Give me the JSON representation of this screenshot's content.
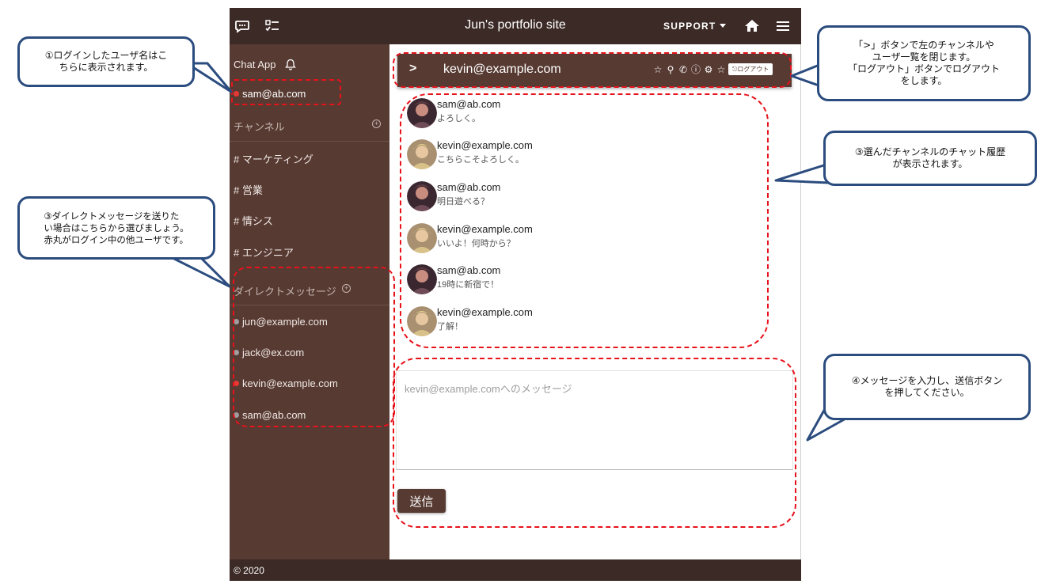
{
  "topbar": {
    "title": "Jun's portfolio site",
    "support_label": "SUPPORT",
    "icons": [
      "chat-bubble-icon",
      "checklist-icon",
      "home-icon",
      "menu-icon"
    ]
  },
  "sidebar": {
    "app_name": "Chat App",
    "current_user": "sam@ab.com",
    "channels_heading": "チャンネル",
    "channels": [
      "# マーケティング",
      "# 営業",
      "# 情シス",
      "# エンジニア"
    ],
    "dm_heading": "ダイレクトメッセージ",
    "direct_users": [
      {
        "name": "jun@example.com",
        "status_color": "#9e9e9e"
      },
      {
        "name": "jack@ex.com",
        "status_color": "#9e9e9e"
      },
      {
        "name": "kevin@example.com",
        "status_color": "#e53935"
      },
      {
        "name": "sam@ab.com",
        "status_color": "#9e9e9e"
      }
    ],
    "online_color": "#e53935"
  },
  "chat": {
    "toggle_label": ">",
    "title": "kevin@example.com",
    "header_icons": [
      "☆",
      "⚲",
      "✆",
      "ⓘ",
      "⚙",
      "☆"
    ],
    "logout_label": "ログアウト",
    "messages": [
      {
        "user": "sam@ab.com",
        "text": "よろしく。"
      },
      {
        "user": "kevin@example.com",
        "text": "こちらこそよろしく。"
      },
      {
        "user": "sam@ab.com",
        "text": "明日遊べる？"
      },
      {
        "user": "kevin@example.com",
        "text": "いいよ！何時から？"
      },
      {
        "user": "sam@ab.com",
        "text": "19時に新宿で！"
      },
      {
        "user": "kevin@example.com",
        "text": "了解！"
      }
    ],
    "input_placeholder": "kevin@example.comへのメッセージ",
    "send_label": "送信"
  },
  "footer": {
    "text": "© 2020"
  },
  "annotations": {
    "login_user": "①ログインしたユーザ名はこ\nちらに表示されます。",
    "direct_message": "③ダイレクトメッセージを送りた\nい場合はこちらから選びましょう。\n赤丸がログイン中の他ユーザです。",
    "header_buttons": "「>」ボタンで左のチャンネルや\nユーザ一覧を閉じます。\n「ログアウト」ボタンでログアウト\nをします。",
    "chat_history": "③選んだチャンネルのチャット履歴\nが表示されます。",
    "send_message": "④メッセージを入力し、送信ボタン\nを押してください。"
  }
}
